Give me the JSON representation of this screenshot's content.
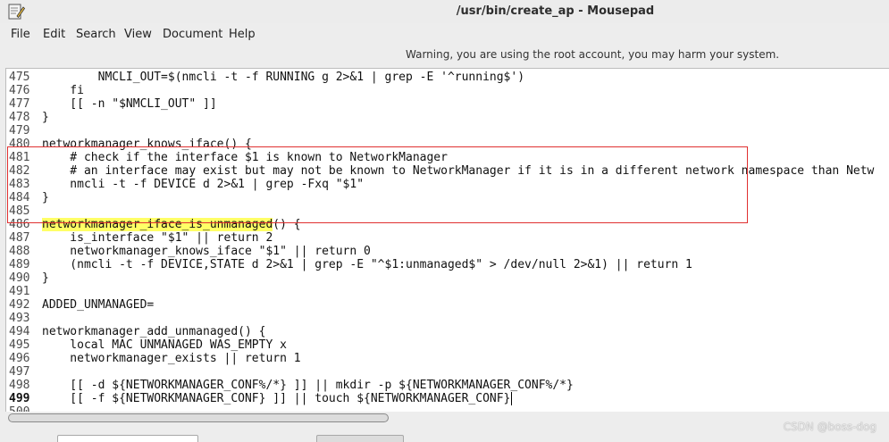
{
  "window": {
    "title": "/usr/bin/create_ap - Mousepad",
    "icon": "notepad-pencil-icon"
  },
  "menu": [
    "File",
    "Edit",
    "Search",
    "View",
    "Document",
    "Help"
  ],
  "warning": "Warning, you are using the root account, you may harm your system.",
  "editor": {
    "current_line": 499,
    "lines": [
      {
        "num": "475",
        "text": "        NMCLI_OUT=$(nmcli -t -f RUNNING g 2>&1 | grep -E '^running$')"
      },
      {
        "num": "476",
        "text": "    fi"
      },
      {
        "num": "477",
        "text": "    [[ -n \"$NMCLI_OUT\" ]]"
      },
      {
        "num": "478",
        "text": "}"
      },
      {
        "num": "479",
        "text": ""
      },
      {
        "num": "480",
        "text": "networkmanager_knows_iface() {"
      },
      {
        "num": "481",
        "text": "    # check if the interface $1 is known to NetworkManager"
      },
      {
        "num": "482",
        "text": "    # an interface may exist but may not be known to NetworkManager if it is in a different network namespace than Netw"
      },
      {
        "num": "483",
        "text": "    nmcli -t -f DEVICE d 2>&1 | grep -Fxq \"$1\""
      },
      {
        "num": "484",
        "text": "}"
      },
      {
        "num": "485",
        "text": ""
      },
      {
        "num": "486",
        "highlight": "networkmanager_iface_is_unmanaged",
        "text": "() {"
      },
      {
        "num": "487",
        "text": "    is_interface \"$1\" || return 2"
      },
      {
        "num": "488",
        "text": "    networkmanager_knows_iface \"$1\" || return 0"
      },
      {
        "num": "489",
        "text": "    (nmcli -t -f DEVICE,STATE d 2>&1 | grep -E \"^$1:unmanaged$\" > /dev/null 2>&1) || return 1"
      },
      {
        "num": "490",
        "text": "}"
      },
      {
        "num": "491",
        "text": ""
      },
      {
        "num": "492",
        "text": "ADDED_UNMANAGED="
      },
      {
        "num": "493",
        "text": ""
      },
      {
        "num": "494",
        "text": "networkmanager_add_unmanaged() {"
      },
      {
        "num": "495",
        "text": "    local MAC UNMANAGED WAS_EMPTY x"
      },
      {
        "num": "496",
        "text": "    networkmanager_exists || return 1"
      },
      {
        "num": "497",
        "text": ""
      },
      {
        "num": "498",
        "text": "    [[ -d ${NETWORKMANAGER_CONF%/*} ]] || mkdir -p ${NETWORKMANAGER_CONF%/*}"
      },
      {
        "num": "499",
        "text": "    [[ -f ${NETWORKMANAGER_CONF} ]] || touch ${NETWORKMANAGER_CONF}"
      },
      {
        "num": "500",
        "text": ""
      }
    ]
  },
  "watermark": "CSDN @boss-dog"
}
